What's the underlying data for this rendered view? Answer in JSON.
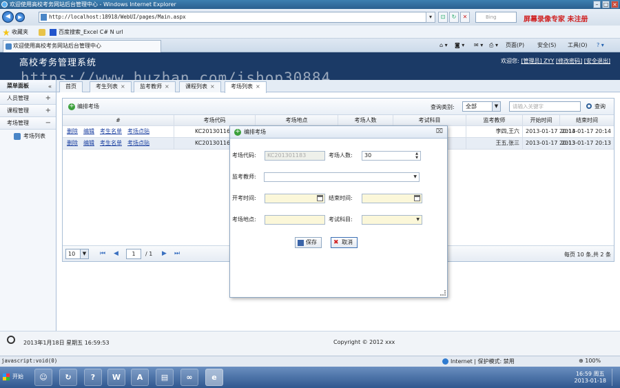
{
  "browser": {
    "title": "欢迎使用高校考务网站后台管理中心 - Windows Internet Explorer",
    "address": "http://localhost:18918/WebUI/pages/Main.aspx",
    "search_placeholder": "Bing",
    "recorder_text": "屏幕录像专家 未注册",
    "favorites_label": "收藏夹",
    "fav_items": [
      "百度搜索_Excel C# N url"
    ],
    "tab_title": "欢迎使用高校考务网站后台管理中心",
    "commands": [
      "页面(P)",
      "安全(S)",
      "工具(O)"
    ],
    "status_text": "javascript:void(0)",
    "zone_text": "Internet | 保护模式: 禁用",
    "zoom": "100%"
  },
  "app": {
    "title": "高校考务管理系统",
    "welcome": "欢迎您:",
    "user": "[管理员] ZYY",
    "change_password": "[修改密码]",
    "logout": "[安全退出]",
    "watermark": "https://www.huzhan.com/ishop30884"
  },
  "sidebar": {
    "header": "菜单面板",
    "groups": [
      {
        "label": "人员管理",
        "toggle": "+"
      },
      {
        "label": "课程管理",
        "toggle": "+"
      },
      {
        "label": "考场管理",
        "toggle": "−"
      }
    ],
    "leaf": "考场列表"
  },
  "tabs": [
    "首页",
    "考生列表",
    "监考教师",
    "课程列表",
    "考场列表"
  ],
  "toolbar": {
    "arrange_label": "编排考场",
    "query_label": "查询类别:",
    "query_select": "全部",
    "query_placeholder": "请输入关键字",
    "query_button": "查询"
  },
  "grid": {
    "columns": [
      "#",
      "考场代码",
      "考场地点",
      "考场人数",
      "考试科目",
      "监考教师",
      "开始时间",
      "结束时间"
    ],
    "actions": [
      "删除",
      "编辑",
      "考生名单",
      "考场点贴"
    ],
    "rows": [
      {
        "code": "KC20130116",
        "place": "",
        "count": "",
        "subject": "",
        "teacher": "李四,王六",
        "start": "2013-01-17 20:14",
        "end": "2013-01-17 20:14"
      },
      {
        "code": "KC20130116",
        "place": "",
        "count": "",
        "subject": "",
        "teacher": "王五,张三",
        "start": "2013-01-17 20:13",
        "end": "2013-01-17 20:13"
      }
    ]
  },
  "pager": {
    "page_size": "10",
    "page": "1",
    "of": "/ 1",
    "summary": "每页 10 条,共 2 条"
  },
  "modal": {
    "title": "编排考场",
    "code_label": "考场代码:",
    "code_value": "KC201301183",
    "count_label": "考场人数:",
    "count_value": "30",
    "teacher_label": "监考教师:",
    "start_label": "开考时间:",
    "end_label": "结束时间:",
    "place_label": "考场地点:",
    "subject_label": "考试科目:",
    "save": "保存",
    "cancel": "取消"
  },
  "footer": {
    "datetime": "2013年1月18日 星期五 16:59:53",
    "copyright": "Copyright © 2012 xxx"
  },
  "taskbar": {
    "start": "开始",
    "time": "16:59 周五",
    "date": "2013-01-18"
  }
}
